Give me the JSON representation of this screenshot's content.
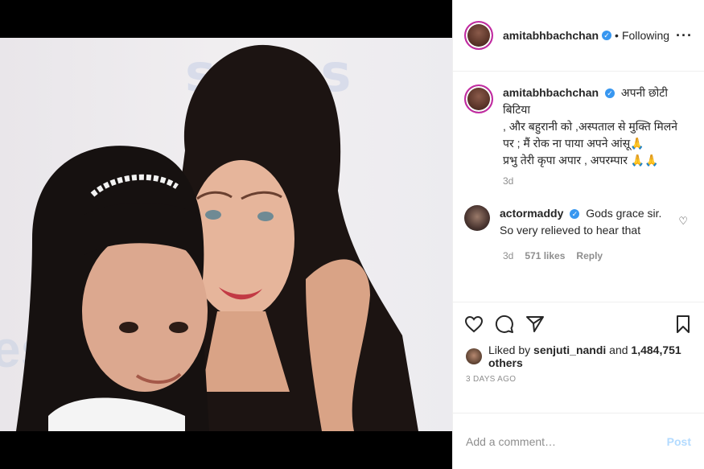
{
  "post": {
    "username": "amitabhbachchan",
    "follow_status": "Following",
    "more_icon": "more-options-icon"
  },
  "photo": {
    "backdrop_text_top": "series",
    "backdrop_text_left": "es"
  },
  "caption": {
    "username": "amitabhbachchan",
    "lines": [
      "अपनी छोटी बिटिया",
      ", और बहुरानी को ,अस्पताल से मुक्ति मिलने",
      "पर ; मैं रोक ना पाया अपने आंसू🙏",
      "प्रभु तेरी कृपा अपार , अपरम्पार 🙏🙏"
    ],
    "age": "3d"
  },
  "comment": {
    "username": "actormaddy",
    "text": "Gods grace sir. So very relieved to hear that",
    "age": "3d",
    "likes": "571 likes",
    "reply": "Reply"
  },
  "likes": {
    "prefix": "Liked by",
    "user": "senjuti_nandi",
    "middle": "and",
    "count": "1,484,751 others"
  },
  "date": "3 DAYS AGO",
  "add_comment": {
    "placeholder": "Add a comment…",
    "post_label": "Post"
  },
  "colors": {
    "verified": "#3897f0",
    "link_disabled": "#b3dbff",
    "muted": "#8e8e8e"
  }
}
